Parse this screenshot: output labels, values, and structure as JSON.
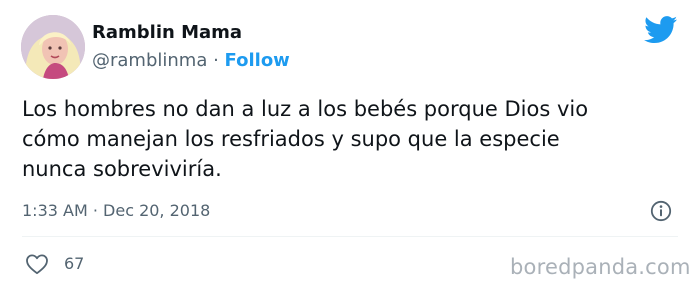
{
  "user": {
    "name": "Ramblin Mama",
    "handle": "@ramblinma",
    "separator": " · ",
    "follow_label": "Follow"
  },
  "tweet": {
    "text": "Los hombres no dan a luz a los bebés porque Dios vio\ncómo manejan los resfriados y supo que la especie\nnunca sobreviviría.",
    "timestamp": "1:33 AM · Dec 20, 2018",
    "like_count": "67"
  },
  "watermark": "boredpanda.com",
  "icons": {
    "brand": "twitter-bird-icon",
    "info": "info-icon",
    "like": "heart-icon"
  },
  "colors": {
    "accent": "#1d9bf0",
    "text": "#0f1419",
    "secondary": "#536471",
    "watermark": "#aab1b8"
  }
}
